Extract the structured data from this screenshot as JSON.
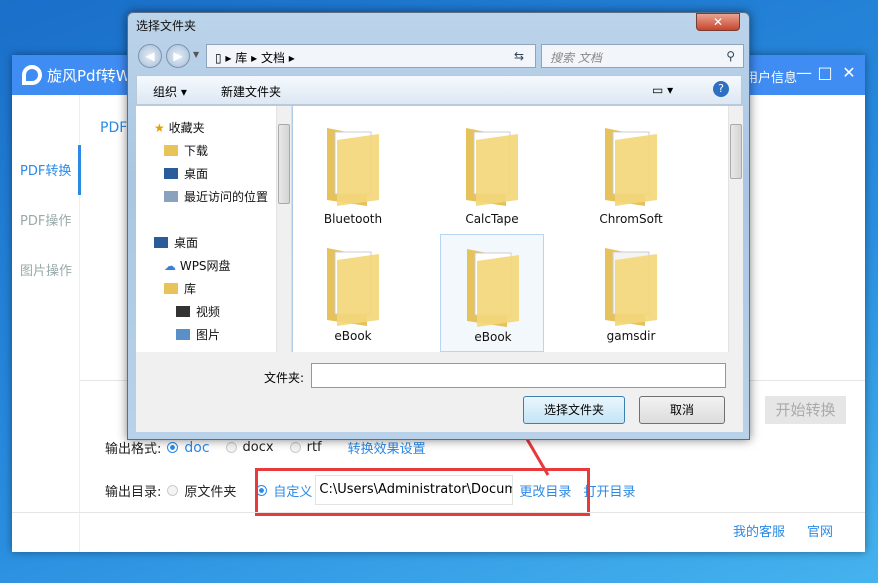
{
  "main": {
    "title": "旋风Pdf转Word",
    "user_info": "用户信息",
    "min": "—",
    "max": "□",
    "close": "✕",
    "tab": "PDF转Word",
    "sidebar": [
      {
        "label": "PDF转换"
      },
      {
        "label": "PDF操作"
      },
      {
        "label": "图片操作"
      }
    ],
    "start_button": "开始转换",
    "output_format": {
      "label": "输出格式:",
      "options": [
        "doc",
        "docx",
        "rtf"
      ],
      "selected": "doc",
      "settings_link": "转换效果设置"
    },
    "output_dir": {
      "label": "输出目录:",
      "options": [
        "原文件夹",
        "自定义"
      ],
      "selected": "自定义",
      "path": "C:\\Users\\Administrator\\Documents",
      "change": "更改目录",
      "open": "打开目录"
    },
    "footer": {
      "support": "我的客服",
      "website": "官网"
    }
  },
  "dialog": {
    "title": "选择文件夹",
    "close": "✕",
    "breadcrumb": [
      "库",
      "文档"
    ],
    "search_placeholder": "搜索 文档",
    "toolbar": {
      "organize": "组织 ▾",
      "new_folder": "新建文件夹",
      "help": "?"
    },
    "nav": [
      {
        "label": "收藏夹",
        "icon": "star-icon"
      },
      {
        "label": "下载",
        "icon": "download-folder-icon"
      },
      {
        "label": "桌面",
        "icon": "desktop-icon"
      },
      {
        "label": "最近访问的位置",
        "icon": "recent-icon"
      },
      {
        "label": "桌面",
        "icon": "desktop-icon"
      },
      {
        "label": "WPS网盘",
        "icon": "cloud-icon"
      },
      {
        "label": "库",
        "icon": "library-icon"
      },
      {
        "label": "视频",
        "icon": "video-icon"
      },
      {
        "label": "图片",
        "icon": "picture-icon"
      }
    ],
    "folders": [
      "Bluetooth",
      "CalcTape",
      "ChromSoft",
      "eBook",
      "eBook",
      "gamsdir"
    ],
    "folder_label": "文件夹:",
    "folder_value": "",
    "select_button": "选择文件夹",
    "cancel_button": "取消"
  },
  "colors": {
    "accent": "#2b8ae6",
    "title_bar": "#3f8cf3",
    "highlight": "#e83a3a"
  }
}
